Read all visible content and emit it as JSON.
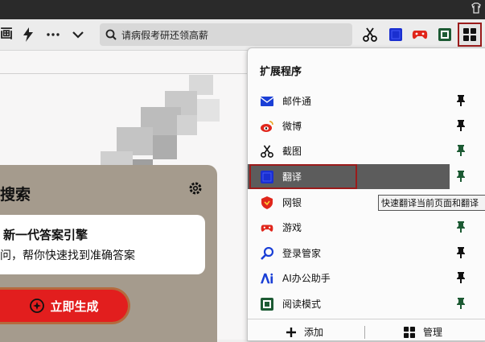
{
  "toolbar": {
    "left_fragment": "画",
    "search_text": "请病假考研还领高薪"
  },
  "page": {
    "card_title": "搜索",
    "answer_title": "新一代答案引擎",
    "answer_subtitle": "问，帮你快速找到准确答案",
    "generate_button": "立即生成",
    "edge_text": "快"
  },
  "extensions_panel": {
    "title": "扩展程序",
    "items": [
      {
        "label": "邮件通",
        "icon": "mail-icon",
        "color": "#1a3fd6"
      },
      {
        "label": "微博",
        "icon": "weibo-icon",
        "color": "#e0261b"
      },
      {
        "label": "截图",
        "icon": "scissors-icon",
        "color": "#111111"
      },
      {
        "label": "翻译",
        "icon": "translate-icon",
        "color": "#1a3fd6",
        "selected": true
      },
      {
        "label": "网银",
        "icon": "shield-icon",
        "color": "#e0261b"
      },
      {
        "label": "游戏",
        "icon": "gamepad-icon",
        "color": "#e0261b"
      },
      {
        "label": "登录管家",
        "icon": "key-icon",
        "color": "#1a3fd6"
      },
      {
        "label": "AI办公助手",
        "icon": "ai-icon",
        "color": "#1a3fd6"
      },
      {
        "label": "阅读模式",
        "icon": "book-icon",
        "color": "#1c6b3a"
      }
    ],
    "footer_add": "添加",
    "footer_manage": "管理"
  },
  "tooltip": "快速翻译当前页面和翻译"
}
